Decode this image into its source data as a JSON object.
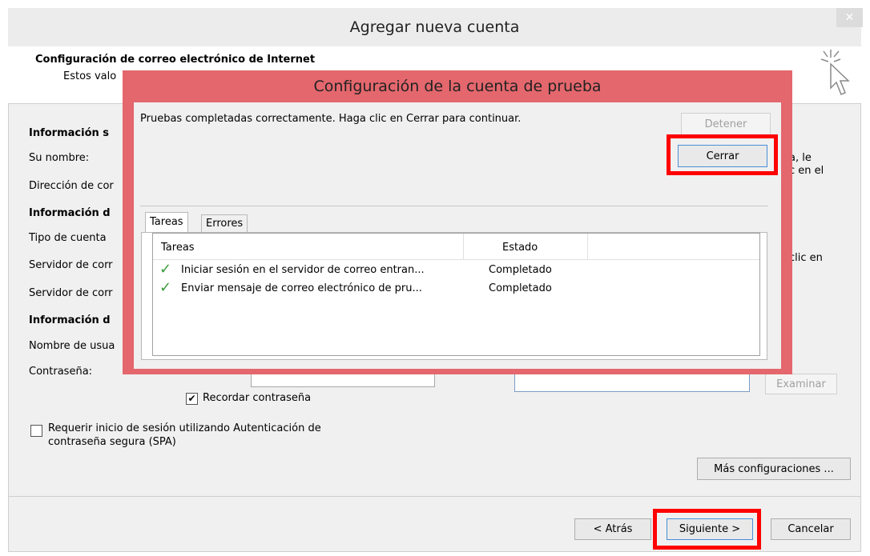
{
  "window": {
    "title": "Agregar nueva cuenta",
    "close_glyph": "✕",
    "header_title": "Configuración de correo electrónico de Internet",
    "header_subtitle": "Estos valo"
  },
  "form": {
    "user_info_heading": "Información s",
    "your_name_label": "Su nombre:",
    "email_label": "Dirección de cor",
    "server_info_heading": "Información d",
    "account_type_label": "Tipo de cuenta",
    "incoming_label": "Servidor de corr",
    "outgoing_label": "Servidor de corr",
    "logon_info_heading": "Información d",
    "username_label": "Nombre de usua",
    "password_label": "Contraseña:",
    "remember_password": "Recordar contraseña",
    "remember_checked": "✔",
    "spa_label_line1": "Requerir inicio de sesión utilizando Autenticación de",
    "spa_label_line2": "contraseña segura (SPA)",
    "right_text_1": "a, le",
    "right_text_2": "c en el",
    "right_text_3": "clic en",
    "browse_button": "Examinar",
    "more_settings_button": "Más configuraciones ..."
  },
  "footer": {
    "back_button": "< Atrás",
    "next_button": "Siguiente >",
    "cancel_button": "Cancelar"
  },
  "dialog": {
    "title": "Configuración de la cuenta de prueba",
    "message": "Pruebas completadas correctamente. Haga clic en Cerrar para continuar.",
    "stop_button": "Detener",
    "close_button": "Cerrar",
    "tabs": [
      {
        "label": "Tareas"
      },
      {
        "label": "Errores"
      }
    ],
    "columns": {
      "task": "Tareas",
      "status": "Estado"
    },
    "rows": [
      {
        "task": "Iniciar sesión en el servidor de correo entran...",
        "status": "Completado"
      },
      {
        "task": "Enviar mensaje de correo electrónico de pru...",
        "status": "Completado"
      }
    ],
    "check_glyph": "✓"
  },
  "colors": {
    "dialog_frame": "#e4676d",
    "highlight": "#ff0000",
    "check_green": "#3a9a3a"
  },
  "icons": {
    "header_icon": "cursor-click-icon"
  }
}
